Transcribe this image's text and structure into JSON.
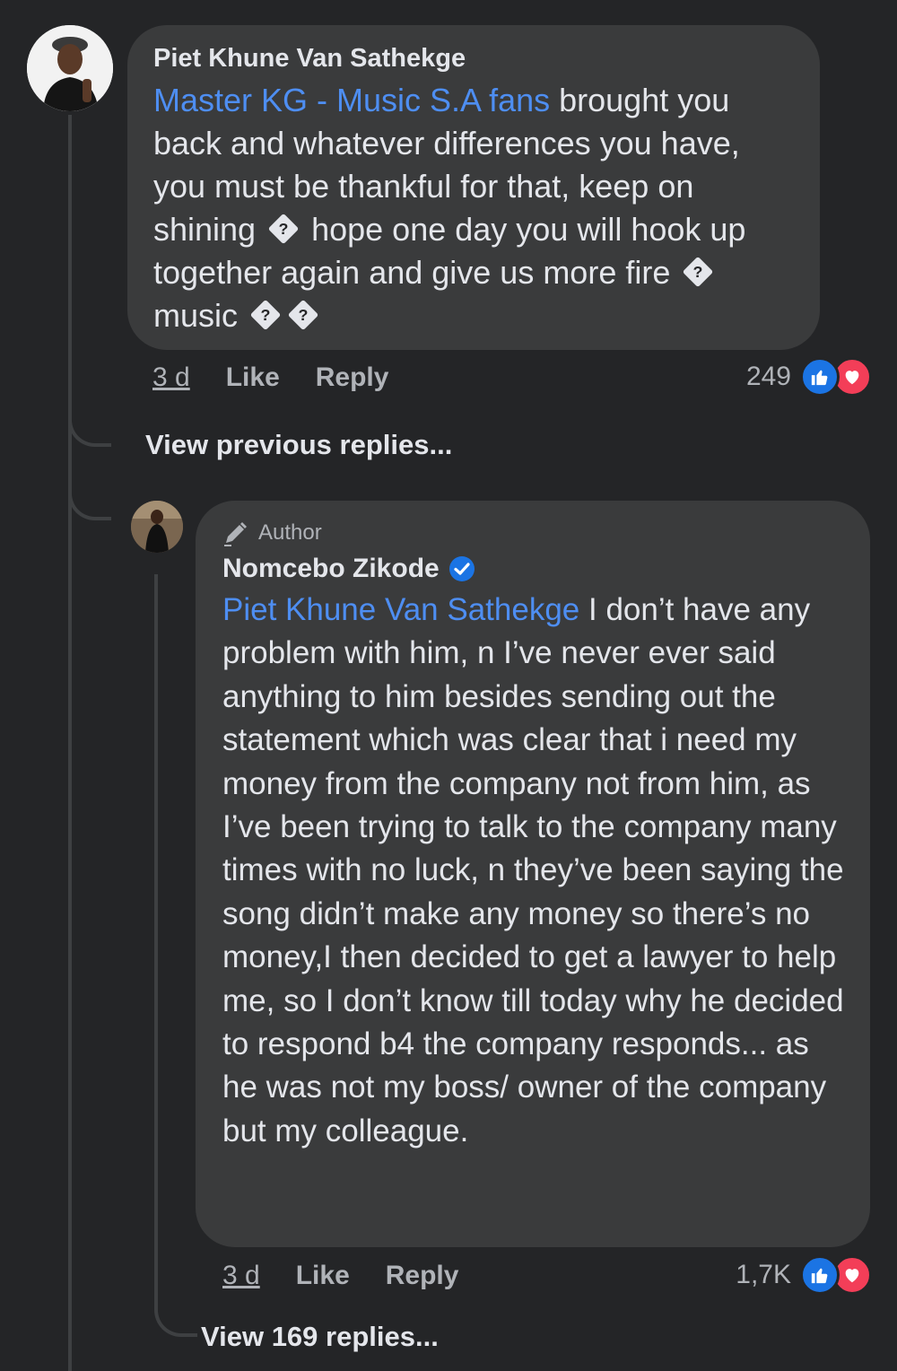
{
  "comment1": {
    "author": "Piet Khune Van Sathekge",
    "mention": "Master KG - Music S.A fans",
    "text_parts": [
      " brought you back and whatever differences you have, you must be thankful for that, keep on shining ",
      " hope one day you will hook up together again and give us more fire ",
      " music "
    ],
    "time": "3 d",
    "like_label": "Like",
    "reply_label": "Reply",
    "reaction_count": "249"
  },
  "view_previous": "View previous replies...",
  "comment2": {
    "badge": "Author",
    "author": "Nomcebo Zikode",
    "mention": "Piet Khune Van Sathekge",
    "text": " I don’t have any problem with him, n I’ve never ever said anything to him besides sending out the statement which was clear that i need my money from the company not from him, as I’ve been trying to talk to the company many times with no luck, n they’ve been saying the song didn’t make any money so there’s no money,I then decided to get a lawyer to help me, so I don’t know till today why he decided to respond b4 the company responds... as he was not my boss/ owner of the company but my colleague.",
    "time": "3 d",
    "like_label": "Like",
    "reply_label": "Reply",
    "reaction_count": "1,7K"
  },
  "view_replies": "View 169 replies...",
  "missing_glyph": "?",
  "colors": {
    "background": "#242527",
    "bubble": "#3a3b3c",
    "mention": "#4e8ef2",
    "like": "#1b74e4",
    "love": "#f33e58",
    "verified": "#1b74e4"
  },
  "icons": [
    "like-icon",
    "love-icon",
    "verified-icon",
    "pencil-icon",
    "missing-emoji-icon"
  ]
}
